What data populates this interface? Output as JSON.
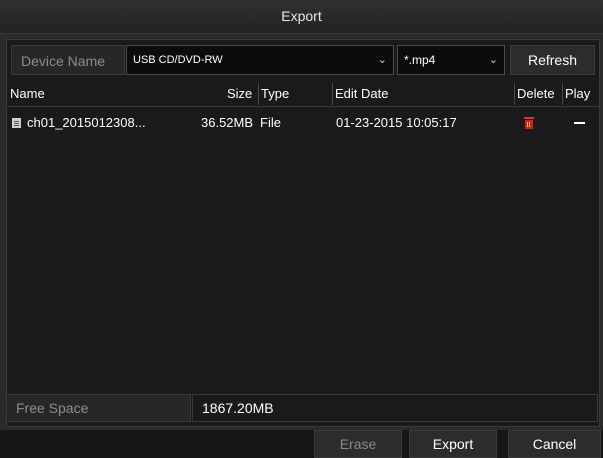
{
  "window": {
    "title": "Export"
  },
  "device": {
    "label": "Device Name",
    "selected": "USB CD/DVD-RW",
    "chevron": "⌄"
  },
  "filter": {
    "selected": "*.mp4",
    "chevron": "⌄"
  },
  "refresh_label": "Refresh",
  "table": {
    "columns": {
      "name": "Name",
      "size": "Size",
      "type": "Type",
      "edit_date": "Edit Date",
      "delete": "Delete",
      "play": "Play"
    },
    "rows": [
      {
        "name": "ch01_2015012308...",
        "size": "36.52MB",
        "type": "File",
        "edit_date": "01-23-2015 10:05:17",
        "icon": "file-icon",
        "delete_icon": "trash-icon",
        "play_icon": "dash-icon"
      }
    ]
  },
  "free_space": {
    "label": "Free Space",
    "value": "1867.20MB"
  },
  "buttons": {
    "erase": "Erase",
    "export": "Export",
    "cancel": "Cancel"
  },
  "colors": {
    "delete_red": "#c8281c",
    "background": "#1a1a1c",
    "chrome": "#2a2a2c"
  }
}
